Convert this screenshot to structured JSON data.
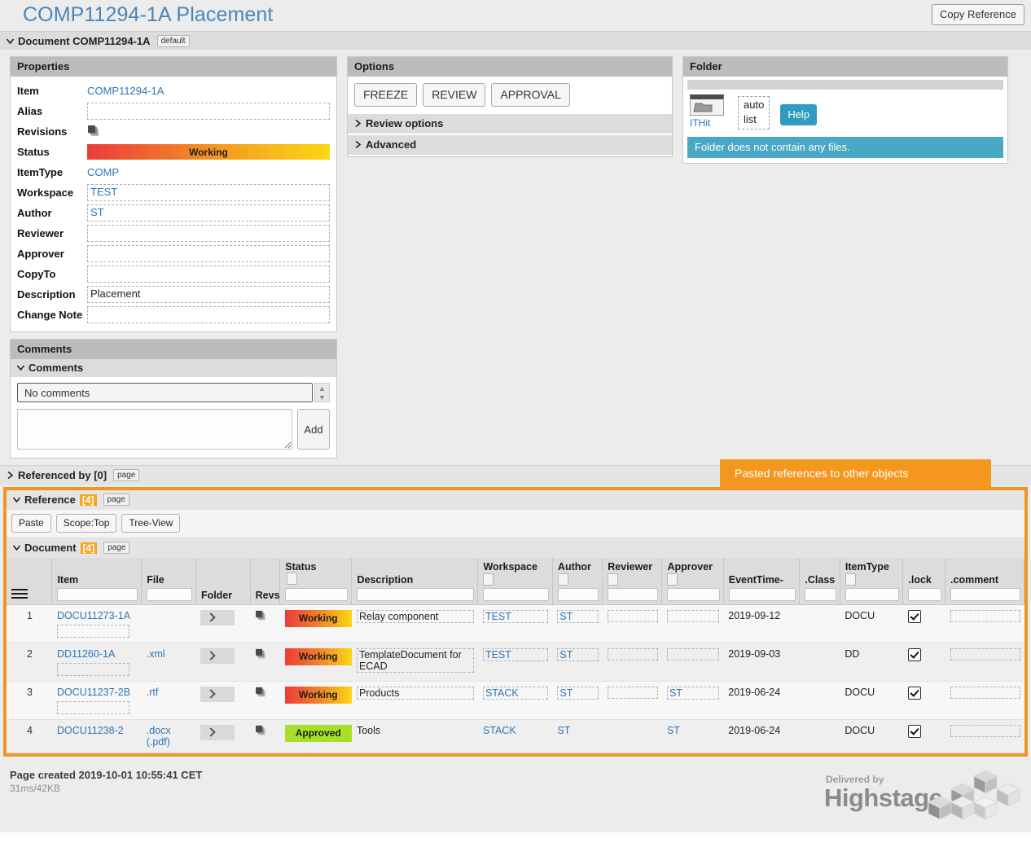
{
  "header": {
    "title": "COMP11294-1A Placement",
    "copy_reference_label": "Copy Reference"
  },
  "document_bar": {
    "label": "Document COMP11294-1A",
    "tag": "default"
  },
  "properties": {
    "panel_title": "Properties",
    "rows": [
      {
        "label": "Item",
        "value": "COMP11294-1A",
        "kind": "link"
      },
      {
        "label": "Alias",
        "value": "",
        "kind": "dashed"
      },
      {
        "label": "Revisions",
        "value": "",
        "kind": "icon"
      },
      {
        "label": "Status",
        "value": "Working",
        "kind": "status"
      },
      {
        "label": "ItemType",
        "value": "COMP",
        "kind": "link"
      },
      {
        "label": "Workspace",
        "value": "TEST",
        "kind": "dashed-link"
      },
      {
        "label": "Author",
        "value": "ST",
        "kind": "dashed-link"
      },
      {
        "label": "Reviewer",
        "value": "",
        "kind": "dashed"
      },
      {
        "label": "Approver",
        "value": "",
        "kind": "dashed"
      },
      {
        "label": "CopyTo",
        "value": "",
        "kind": "dashed"
      },
      {
        "label": "Description",
        "value": "Placement",
        "kind": "dashed-plain"
      },
      {
        "label": "Change Note",
        "value": "",
        "kind": "dashed"
      }
    ]
  },
  "comments": {
    "panel_title": "Comments",
    "section_title": "Comments",
    "empty_text": "No comments",
    "input_value": "",
    "add_label": "Add"
  },
  "options": {
    "panel_title": "Options",
    "buttons": [
      "FREEZE",
      "REVIEW",
      "APPROVAL"
    ],
    "accordions": [
      "Review options",
      "Advanced"
    ]
  },
  "folder": {
    "panel_title": "Folder",
    "ithit_label": "ITHit",
    "auto_label": "auto",
    "list_label": "list",
    "help_label": "Help",
    "message": "Folder does not contain any files."
  },
  "referenced_by": {
    "label": "Referenced by [0]",
    "page_tag": "page"
  },
  "reference": {
    "label": "Reference",
    "count": "[4]",
    "page_tag": "page",
    "toolbar": [
      "Paste",
      "Scope:Top",
      "Tree-View"
    ],
    "document_label": "Document",
    "document_count": "[4]",
    "document_page_tag": "page"
  },
  "tooltip": {
    "text": "Pasted references to other objects"
  },
  "table": {
    "columns": [
      "Item",
      "File",
      "Folder",
      "Revs",
      "Status",
      "Description",
      "Workspace",
      "Author",
      "Reviewer",
      "Approver",
      "EventTime-",
      ".Class",
      "ItemType",
      ".lock",
      ".comment"
    ],
    "rows": [
      {
        "num": "1",
        "item": "DOCU11273-1A",
        "file": "",
        "status": "Working",
        "description": "Relay component",
        "workspace": "TEST",
        "author": "ST",
        "reviewer": "",
        "approver": "",
        "eventtime": "2019-09-12",
        "class": "",
        "itemtype": "DOCU",
        "lock": true,
        "comment": ""
      },
      {
        "num": "2",
        "item": "DD11260-1A",
        "file": ".xml",
        "status": "Working",
        "description": "TemplateDocument for ECAD",
        "workspace": "TEST",
        "author": "ST",
        "reviewer": "",
        "approver": "",
        "eventtime": "2019-09-03",
        "class": "",
        "itemtype": "DD",
        "lock": true,
        "comment": ""
      },
      {
        "num": "3",
        "item": "DOCU11237-2B",
        "file": ".rtf",
        "status": "Working",
        "description": "Products",
        "workspace": "STACK",
        "author": "ST",
        "reviewer": "",
        "approver": "ST",
        "eventtime": "2019-06-24",
        "class": "",
        "itemtype": "DOCU",
        "lock": true,
        "comment": ""
      },
      {
        "num": "4",
        "item": "DOCU11238-2",
        "file": ".docx (.pdf)",
        "status": "Approved",
        "description": "Tools",
        "workspace": "STACK",
        "author": "ST",
        "reviewer": "",
        "approver": "ST",
        "eventtime": "2019-06-24",
        "class": "",
        "itemtype": "DOCU",
        "lock": true,
        "comment": ""
      }
    ]
  },
  "footer": {
    "created": "Page created 2019-10-01 10:55:41 CET",
    "perf": "31ms/42KB",
    "delivered_by": "Delivered by",
    "brand": "Highstage"
  },
  "colors": {
    "accent_link": "#2e75b6",
    "highlight_orange": "#f39422",
    "status_working_start": "#ec3b3b",
    "status_working_end": "#fbd713",
    "status_approved": "#a8e029",
    "info_teal": "#49a8c4"
  }
}
